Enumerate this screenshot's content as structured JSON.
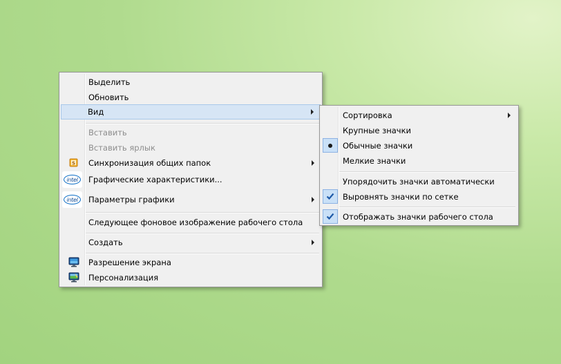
{
  "desktop": {
    "context_menu": {
      "items": [
        {
          "label": "Выделить"
        },
        {
          "label": "Обновить"
        },
        {
          "label": "Вид"
        },
        {
          "label": "Вставить"
        },
        {
          "label": "Вставить ярлык"
        },
        {
          "label": "Синхронизация общих папок"
        },
        {
          "label": "Графические характеристики..."
        },
        {
          "label": "Параметры графики"
        },
        {
          "label": "Следующее фоновое изображение рабочего стола"
        },
        {
          "label": "Создать"
        },
        {
          "label": "Разрешение экрана"
        },
        {
          "label": "Персонализация"
        }
      ],
      "intel_logo_text": "intel"
    },
    "view_submenu": {
      "items": [
        {
          "label": "Сортировка"
        },
        {
          "label": "Крупные значки"
        },
        {
          "label": "Обычные значки",
          "selected": true
        },
        {
          "label": "Мелкие значки"
        },
        {
          "label": "Упорядочить значки автоматически",
          "checked": false
        },
        {
          "label": "Выровнять значки по сетке",
          "checked": true
        },
        {
          "label": "Отображать значки рабочего стола",
          "checked": true
        }
      ]
    }
  },
  "colors": {
    "menu_bg": "#f0f0f0",
    "highlight_bg": "#d6e5f5",
    "check_bg": "#c9e0f7",
    "check_mark": "#1e5aa8",
    "disabled_text": "#8d8d8d"
  }
}
